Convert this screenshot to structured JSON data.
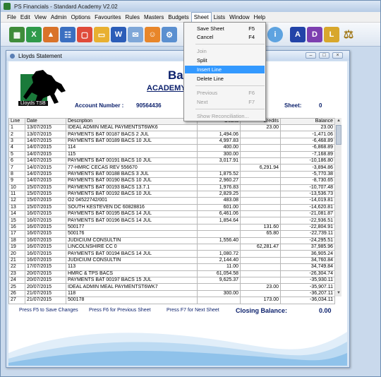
{
  "app": {
    "title": "PS Financials - Standard Academy V2.02"
  },
  "menu": [
    "File",
    "Edit",
    "View",
    "Admin",
    "Options",
    "Favourites",
    "Rules",
    "Masters",
    "Budgets",
    "Sheet",
    "Lists",
    "Window",
    "Help"
  ],
  "toolbar": {
    "letters": {
      "a": "A",
      "d": "D",
      "l": "L"
    }
  },
  "window": {
    "title": "Lloyds Statement"
  },
  "statement": {
    "logo_text": "Lloyds TSB",
    "bank_name": "Ban",
    "account_name": "ACADEMY",
    "account_label": "Account Number :",
    "account_number": "90564436",
    "sheet_label": "Sheet:",
    "sheet_value": "0",
    "columns": {
      "line": "Line",
      "date": "Date",
      "description": "Description",
      "debits": "Debits",
      "credits": "Credits",
      "balance": "Balance"
    },
    "rows": [
      [
        "1",
        "13/07/2015",
        "IDEAL ADMIN MEAL PAYMENTST6WK6",
        "",
        "23.00",
        "23.00"
      ],
      [
        "2",
        "13/07/2015",
        "PAYMENTS BAT 00187 BACS 2 JUL",
        "1,494.06",
        "",
        "-1,471.06"
      ],
      [
        "3",
        "14/07/2015",
        "PAYMENTS BAT 00189 BACS 10 JUL",
        "4,997.83",
        "",
        "-6,468.89"
      ],
      [
        "4",
        "14/07/2015",
        "114",
        "400.00",
        "",
        "-6,868.89"
      ],
      [
        "5",
        "14/07/2015",
        "115",
        "300.00",
        "",
        "-7,168.89"
      ],
      [
        "6",
        "14/07/2015",
        "PAYMENTS BAT 00191 BACS 10 JUL",
        "3,017.91",
        "",
        "-10,186.80"
      ],
      [
        "7",
        "14/07/2015",
        "77-HMRC CECAS REV 556670",
        "",
        "6,291.94",
        "-3,894.86"
      ],
      [
        "8",
        "14/07/2015",
        "PAYMENTS BAT 00188 BACS 3 JUL",
        "1,875.52",
        "",
        "-5,770.38"
      ],
      [
        "9",
        "14/07/2015",
        "PAYMENTS BAT 00190 BACS 10 JUL",
        "2,960.27",
        "",
        "-8,730.65"
      ],
      [
        "10",
        "15/07/2015",
        "PAYMENTS BAT 00193 BACS 13.7.1",
        "1,976.83",
        "",
        "-10,707.48"
      ],
      [
        "11",
        "15/07/2015",
        "PAYMENTS BAT 00192 BACS 10 JUL",
        "2,829.25",
        "",
        "-13,536.73"
      ],
      [
        "12",
        "15/07/2015",
        "O2 04522742/001",
        "483.08",
        "",
        "-14,019.81"
      ],
      [
        "13",
        "15/07/2015",
        "SOUTH KESTEVEN DC 60828816",
        "601.00",
        "",
        "-14,620.81"
      ],
      [
        "14",
        "16/07/2015",
        "PAYMENTS BAT 00195 BACS 14 JUL",
        "6,461.06",
        "",
        "-21,081.87"
      ],
      [
        "15",
        "16/07/2015",
        "PAYMENTS BAT 00196 BACS 14 JUL",
        "1,854.64",
        "",
        "-22,936.51"
      ],
      [
        "16",
        "16/07/2015",
        "500177",
        "",
        "131.60",
        "-22,804.91"
      ],
      [
        "17",
        "16/07/2015",
        "500176",
        "",
        "65.80",
        "-22,739.11"
      ],
      [
        "18",
        "16/07/2015",
        "JUDICIUM CONSULTIN",
        "1,556.40",
        "",
        "-24,295.51"
      ],
      [
        "19",
        "16/07/2015",
        "LINCOLNSHIRE CC 0",
        "",
        "62,281.47",
        "37,985.96"
      ],
      [
        "20",
        "16/07/2015",
        "PAYMENTS BAT 00194 BACS 14 JUL",
        "1,080.72",
        "",
        "36,905.24"
      ],
      [
        "21",
        "16/07/2015",
        "JUDICIUM CONSULTIN",
        "2,144.40",
        "",
        "34,760.84"
      ],
      [
        "22",
        "17/07/2015",
        "113",
        "11.00",
        "",
        "34,749.84"
      ],
      [
        "23",
        "20/07/2015",
        "HMRC & TPS           BACS",
        "61,054.58",
        "",
        "-26,304.74"
      ],
      [
        "24",
        "20/07/2015",
        "PAYMENTS BAT 00197 BACS 15 JUL",
        "9,625.37",
        "",
        "-35,930.11"
      ],
      [
        "25",
        "20/07/2015",
        "IDEAL ADMIN MEAL PAYMENTST6WK7",
        "",
        "23.00",
        "-35,907.11"
      ],
      [
        "26",
        "21/07/2015",
        "118",
        "300.00",
        "",
        "-36,207.11"
      ],
      [
        "27",
        "21/07/2015",
        "500178",
        "",
        "173.00",
        "-36,034.11"
      ]
    ],
    "footer": {
      "f5": "Press F5 to Save Changes",
      "f6": "Press F6 for Previous Sheet",
      "f7": "Press F7 for Next Sheet",
      "closing_label": "Closing Balance:",
      "closing_value": "0.00"
    }
  },
  "sheet_menu": {
    "save": {
      "label": "Save Sheet",
      "shortcut": "F5"
    },
    "cancel": {
      "label": "Cancel",
      "shortcut": "F4"
    },
    "join": {
      "label": "Join"
    },
    "split": {
      "label": "Split"
    },
    "insert": {
      "label": "Insert Line"
    },
    "delete": {
      "label": "Delete Line"
    },
    "previous": {
      "label": "Previous",
      "shortcut": "F6"
    },
    "next": {
      "label": "Next",
      "shortcut": "F7"
    },
    "show_reconciliation": {
      "label": "Show Reconciliation..."
    }
  }
}
